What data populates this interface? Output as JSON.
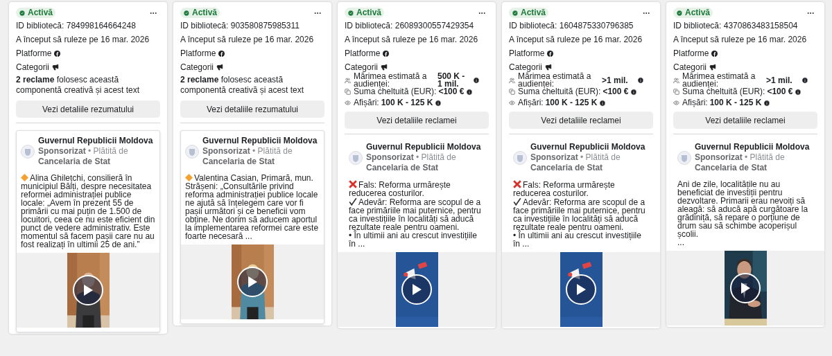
{
  "cards": [
    {
      "kind": "summary",
      "status": "Activă",
      "library_id": "ID bibliotecă: 784998164664248",
      "started": "A început să ruleze pe 16 mar. 2026",
      "platforms": "Platforme",
      "categories": "Categorii",
      "reuse": "**2 reclame** folosesc această componentă creativă și acest text",
      "button": "Vezi detaliile rezumatului",
      "post": {
        "framed": true,
        "page": "Guvernul Republicii Moldova",
        "sponsored": "Sponsorizat",
        "separator": "•",
        "paid_by": "Plătită de",
        "payer": "Cancelaria de Stat",
        "paragraphs": [
          {
            "kind": "diamond",
            "text": "Alina Ghilețchi, consilieră în municipiul Bălți, despre necesitatea reformei administrației publice locale: „Avem în prezent 55 de primării cu mai puțin de 1.500 de locuitori, ceea ce nu este eficient din punct de vedere administrativ. Este momentul să facem pașii care nu au fost realizați în ultimii 25 de ani.”"
          }
        ]
      }
    },
    {
      "kind": "summary",
      "status": "Activă",
      "library_id": "ID bibliotecă: 903580875985311",
      "started": "A început să ruleze pe 16 mar. 2026",
      "platforms": "Platforme",
      "categories": "Categorii",
      "reuse": "**2 reclame** folosesc această componentă creativă și acest text",
      "button": "Vezi detaliile rezumatului",
      "post": {
        "framed": true,
        "page": "Guvernul Republicii Moldova",
        "sponsored": "Sponsorizat",
        "separator": "•",
        "paid_by": "Plătită de",
        "payer": "Cancelaria de Stat",
        "paragraphs": [
          {
            "kind": "diamond",
            "text": "Valentina Casian, Primară, mun. Strășeni: „Consultările privind reforma administrației publice locale ne ajută să înțelegem care vor fi pașii următori și ce beneficii vom obține. Ne dorim să aducem aportul la implementarea reformei care este foarte necesară ..."
          }
        ]
      }
    },
    {
      "kind": "metrics",
      "status": "Activă",
      "library_id": "ID bibliotecă: 26089300557429354",
      "started": "A început să ruleze pe 16 mar. 2026",
      "platforms": "Platforme",
      "categories": "Categorii",
      "metrics": [
        {
          "kind": "audience",
          "label": "Mărimea estimată a audienței:",
          "value": "500 K - 1 mil."
        },
        {
          "kind": "spend",
          "label": "Suma cheltuită (EUR):",
          "value": "<100 €"
        },
        {
          "kind": "impressions",
          "label": "Afișări:",
          "value": "100 K - 125 K"
        }
      ],
      "button": "Vezi detaliile reclamei",
      "post": {
        "framed": false,
        "page": "Guvernul Republicii Moldova",
        "sponsored": "Sponsorizat",
        "separator": "•",
        "paid_by": "Plătită de",
        "payer": "Cancelaria de Stat",
        "paragraphs": [
          {
            "kind": "cross",
            "text": "Fals: Reforma urmărește reducerea costurilor."
          },
          {
            "kind": "check",
            "text": "Adevăr: Reforma are scopul de a face primăriile mai puternice, pentru ca investițiile în localități să aducă rezultate reale pentru oameni."
          },
          {
            "kind": "plain",
            "text": "• În ultimii ani au crescut investițiile în ..."
          }
        ]
      }
    },
    {
      "kind": "metrics",
      "status": "Activă",
      "library_id": "ID bibliotecă: 1604875330796385",
      "started": "A început să ruleze pe 16 mar. 2026",
      "platforms": "Platforme",
      "categories": "Categorii",
      "metrics": [
        {
          "kind": "audience",
          "label": "Mărimea estimată a audienței:",
          "value": ">1 mil."
        },
        {
          "kind": "spend",
          "label": "Suma cheltuită (EUR):",
          "value": "<100 €"
        },
        {
          "kind": "impressions",
          "label": "Afișări:",
          "value": "100 K - 125 K"
        }
      ],
      "button": "Vezi detaliile reclamei",
      "post": {
        "framed": false,
        "page": "Guvernul Republicii Moldova",
        "sponsored": "Sponsorizat",
        "separator": "•",
        "paid_by": "Plătită de",
        "payer": "Cancelaria de Stat",
        "paragraphs": [
          {
            "kind": "cross",
            "text": "Fals: Reforma urmărește reducerea costurilor."
          },
          {
            "kind": "check",
            "text": "Adevăr: Reforma are scopul de a face primăriile mai puternice, pentru ca investițiile în localități să aducă rezultate reale pentru oameni."
          },
          {
            "kind": "plain",
            "text": "• În ultimii ani au crescut investițiile în ..."
          }
        ]
      }
    },
    {
      "kind": "metrics",
      "status": "Activă",
      "library_id": "ID bibliotecă: 4370863483158504",
      "started": "A început să ruleze pe 16 mar. 2026",
      "platforms": "Platforme",
      "categories": "Categorii",
      "metrics": [
        {
          "kind": "audience",
          "label": "Mărimea estimată a audienței:",
          "value": ">1 mil."
        },
        {
          "kind": "spend",
          "label": "Suma cheltuită (EUR):",
          "value": "<100 €"
        },
        {
          "kind": "impressions",
          "label": "Afișări:",
          "value": "100 K - 125 K"
        }
      ],
      "button": "Vezi detaliile reclamei",
      "post": {
        "framed": false,
        "page": "Guvernul Republicii Moldova",
        "sponsored": "Sponsorizat",
        "separator": "•",
        "paid_by": "Plătită de",
        "payer": "Cancelaria de Stat",
        "paragraphs": [
          {
            "kind": "plain",
            "text": "Ani de zile, localitățile nu au beneficiat de investiții pentru dezvoltare. Primarii erau nevoiți să aleagă: să aducă apă curgătoare la grădiniță, să repare o porțiune de drum sau să schimbe acoperișul școlii."
          },
          {
            "kind": "plain",
            "text": "..."
          }
        ]
      }
    }
  ]
}
